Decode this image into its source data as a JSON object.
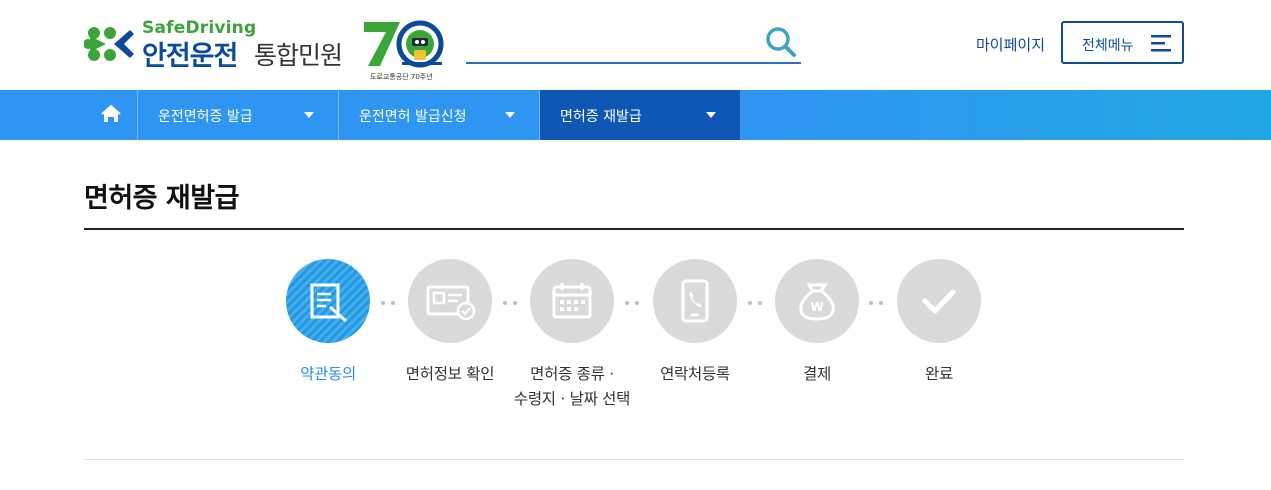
{
  "header": {
    "logo_sub": "SafeDriving",
    "logo_main": "안전운전",
    "logo_main2": "통합민원",
    "anniversary_caption": "도로교통공단 70주년",
    "search": {
      "placeholder": "",
      "value": "",
      "icon": "search-icon"
    },
    "mypage_label": "마이페이지",
    "allmenu_label": "전체메뉴"
  },
  "nav": {
    "home_icon": "home-icon",
    "items": [
      {
        "label": "운전면허증 발급"
      },
      {
        "label": "운전면허 발급신청"
      },
      {
        "label": "면허증 재발급"
      }
    ]
  },
  "page": {
    "title": "면허증 재발급"
  },
  "steps": [
    {
      "label": "약관동의",
      "icon": "document-edit-icon",
      "active": true
    },
    {
      "label": "면허정보 확인",
      "icon": "id-card-check-icon",
      "active": false
    },
    {
      "label_line1": "면허증 종류 ·",
      "label_line2": "수령지 · 날짜 선택",
      "icon": "calendar-icon",
      "active": false
    },
    {
      "label": "연락처등록",
      "icon": "phone-icon",
      "active": false
    },
    {
      "label": "결제",
      "icon": "money-bag-icon",
      "active": false
    },
    {
      "label": "완료",
      "icon": "check-icon",
      "active": false
    }
  ],
  "colors": {
    "brand_navy": "#0c4a9c",
    "brand_green": "#3ba53a",
    "nav_blue": "#2e95f2",
    "nav_active": "#0f57b5",
    "step_active": "#1f9be6",
    "step_inactive": "#dadada"
  }
}
